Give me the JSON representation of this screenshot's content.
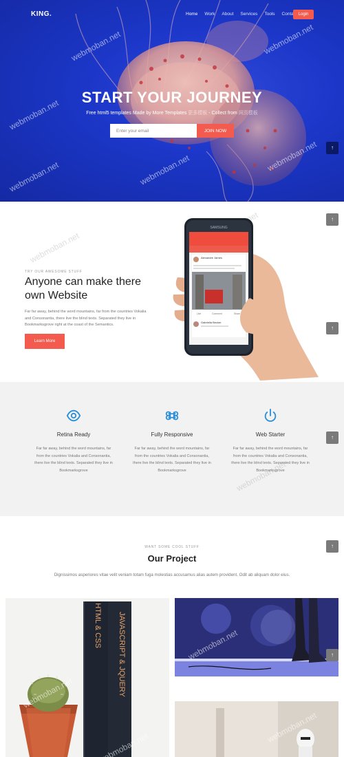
{
  "nav": {
    "logo": "KING.",
    "links": [
      "Home",
      "Work",
      "About",
      "Services",
      "Tools",
      "Contact"
    ],
    "login": "Login"
  },
  "hero": {
    "title": "START YOUR JOURNEY",
    "subtitle": "Free html5 templates Made by More Templates",
    "subtitle_faint": "更多模板",
    "subtitle_end": " - Collect from",
    "subtitle_link": "网页模板",
    "email_placeholder": "Enter your email",
    "join": "JOIN NOW"
  },
  "about": {
    "eyebrow": "TRY OUR AWESOME STUFF",
    "title": "Anyone can make there own Website",
    "text": "Far far away, behind the word mountains, far from the countries Vokalia and Consonantia, there live the blind texts. Separated they live in Bookmarksgrove right at the coast of the Semantics.",
    "button": "Learn More",
    "phone": {
      "brand": "SAMSUNG",
      "post1_author": "Alexandre James",
      "post1_text": "Lorem ipsum dolor sit amet, consectetur adipiscing elit, sed do eiusmod tempor incididunt.",
      "actions": [
        "Like",
        "Comment",
        "Share"
      ],
      "post2_author": "Gabriella Becker"
    }
  },
  "features": [
    {
      "icon": "eye-icon",
      "title": "Retina Ready",
      "text": "Far far away, behind the word mountains, far from the countries Vokalia and Consonantia, there live the blind texts. Separated they live in Bookmarksgrove"
    },
    {
      "icon": "command-icon",
      "title": "Fully Responsive",
      "text": "Far far away, behind the word mountains, far from the countries Vokalia and Consonantia, there live the blind texts. Separated they live in Bookmarksgrove"
    },
    {
      "icon": "power-icon",
      "title": "Web Starter",
      "text": "Far far away, behind the word mountains, far from the countries Vokalia and Consonantia, there live the blind texts. Separated they live in Bookmarksgrove"
    }
  ],
  "project": {
    "eyebrow": "WANT SOME COOL STUFF",
    "title": "Our Project",
    "text": "Dignissimos asperiores vitae velit veniam totam fuga molestias accusamus alias autem provident. Odit ab aliquam dolor eius.",
    "book1": "HTML & CSS",
    "book2": "JAVASCRIPT & JQUERY"
  },
  "watermark": "webmoban.net",
  "colors": {
    "accent": "#f35b4f",
    "hero_blue": "#1c37c9",
    "icon_blue": "#2b8fd8"
  }
}
